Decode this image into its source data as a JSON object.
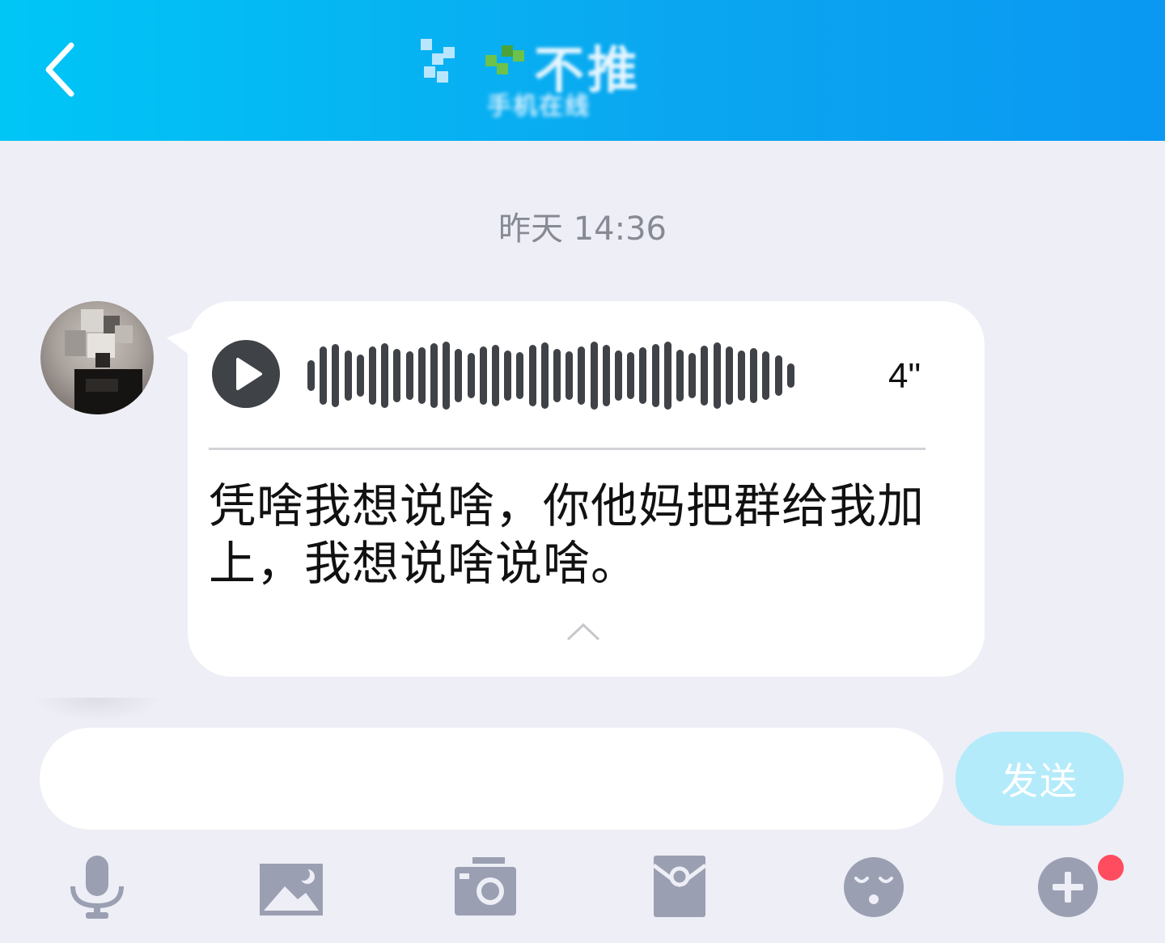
{
  "header": {
    "title": "不推",
    "subtitle": "手机在线"
  },
  "chat": {
    "timestamp": "昨天 14:36",
    "message": {
      "type": "voice",
      "duration": "4\"",
      "transcript": "凭啥我想说啥，你他妈把群给我加上，我想说啥说啥。"
    }
  },
  "input": {
    "placeholder": "",
    "send_label": "发送"
  },
  "toolbar": {
    "icons": [
      "microphone-icon",
      "image-icon",
      "camera-icon",
      "red-packet-icon",
      "emoji-icon",
      "plus-icon"
    ],
    "plus_has_notification": true
  },
  "colors": {
    "header_start": "#00c6f6",
    "header_end": "#0a98f2",
    "background": "#eeeef6",
    "bubble": "#ffffff",
    "icon_gray": "#9a9fb2",
    "send_button": "#b4ebfb",
    "notification_dot": "#ff4c5e"
  }
}
